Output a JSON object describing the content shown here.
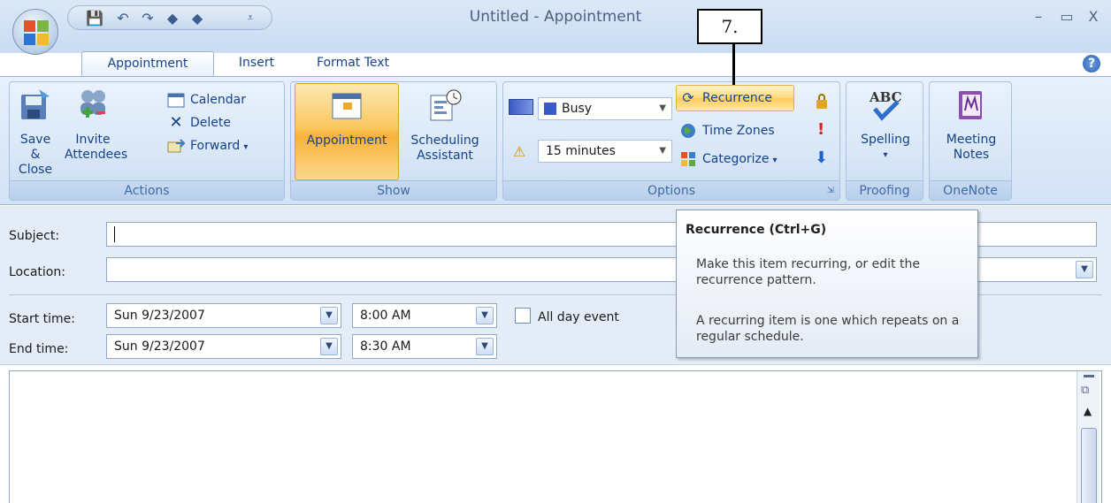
{
  "window": {
    "title": "Untitled - Appointment",
    "min": "–",
    "max": "▭",
    "close": "X"
  },
  "callout": {
    "label": "7."
  },
  "tabs": [
    {
      "label": "Appointment"
    },
    {
      "label": "Insert"
    },
    {
      "label": "Format Text"
    }
  ],
  "ribbon": {
    "actions": {
      "label": "Actions",
      "save_close": "Save & Close",
      "invite": "Invite Attendees",
      "calendar": "Calendar",
      "delete": "Delete",
      "forward": "Forward"
    },
    "show": {
      "label": "Show",
      "appointment": "Appointment",
      "scheduling": "Scheduling Assistant"
    },
    "options": {
      "label": "Options",
      "show_as": "Busy",
      "reminder": "15 minutes",
      "recurrence": "Recurrence",
      "time_zones": "Time Zones",
      "categorize": "Categorize"
    },
    "proofing": {
      "label": "Proofing",
      "spelling": "Spelling"
    },
    "onenote": {
      "label": "OneNote",
      "meeting_notes": "Meeting Notes"
    }
  },
  "form": {
    "subject_label": "Subject:",
    "location_label": "Location:",
    "start_label": "Start time:",
    "end_label": "End time:",
    "start_date": "Sun 9/23/2007",
    "start_time": "8:00 AM",
    "end_date": "Sun 9/23/2007",
    "end_time": "8:30 AM",
    "all_day": "All day event"
  },
  "tooltip": {
    "title": "Recurrence (Ctrl+G)",
    "line1": "Make this item recurring, or edit the recurrence pattern.",
    "line2": "A recurring item is one which repeats on a regular schedule."
  },
  "colors": {
    "accent": "#15428b",
    "busy": "#3a5bc7",
    "highlight": "#ffcb58"
  }
}
